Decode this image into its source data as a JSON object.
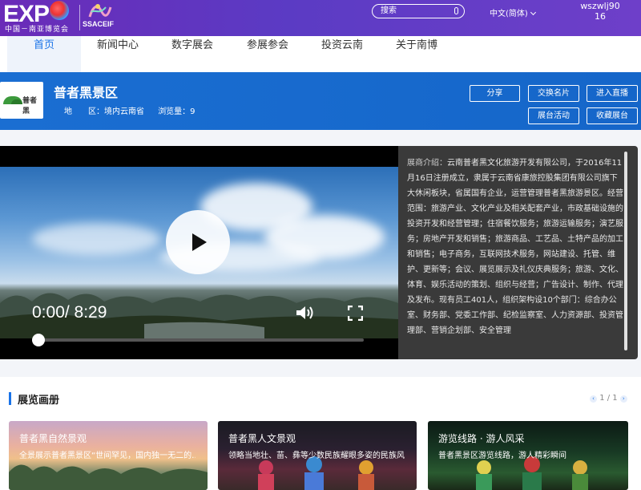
{
  "topbar": {
    "logo_text": "EXP",
    "logo_sub": "中国－南亚博览会",
    "logo_ssaceif": "SSACEIF",
    "search_placeholder": "搜索",
    "language": "中文(简体)",
    "user_line1": "wszwlj90",
    "user_line2": "16"
  },
  "nav": {
    "items": [
      {
        "label": "首页",
        "active": true
      },
      {
        "label": "新闻中心"
      },
      {
        "label": "数字展会"
      },
      {
        "label": "参展参会"
      },
      {
        "label": "投资云南"
      },
      {
        "label": "关于南博"
      }
    ]
  },
  "exhibitor": {
    "logo_text": "普者黑",
    "name": "普者黑景区",
    "region_label": "地　　区：境内云南省",
    "views_label": "浏览量：9",
    "buttons": {
      "share": "分享",
      "exchange_card": "交换名片",
      "live": "进入直播",
      "booth_activity": "展台活动",
      "favorite": "收藏展台"
    }
  },
  "player": {
    "time": "0:00/ 8:29",
    "progress": 0
  },
  "intro": {
    "label": "展商介绍：",
    "text": "云南普者黑文化旅游开发有限公司，于2016年11月16日注册成立，隶属于云南省康旅控股集团有限公司旗下大休闲板块，省属国有企业，运营管理普者黑旅游景区。经营范围：旅游产业、文化产业及相关配套产业，市政基础设施的投资开发和经营管理；住宿餐饮服务；旅游运输服务；演艺服务；房地产开发和销售；旅游商品、工艺品、土特产品的加工和销售；电子商务，互联网技术服务，网站建设、托管、维护、更新等；会议、展览展示及礼仪庆典服务；旅游、文化、体育、娱乐活动的策划、组织与经营；广告设计、制作、代理及发布。现有员工401人，组织架构设10个部门：综合办公室、财务部、党委工作部、纪检监察室、人力资源部、投资管理部、营销企划部、安全管理"
  },
  "album": {
    "title": "展览画册",
    "pager": "1 / 1",
    "cards": [
      {
        "title": "普者黑自然景观",
        "desc": "全景展示普者黑景区“世间罕见，国内独一无二的…"
      },
      {
        "title": "普者黑人文景观",
        "desc": "领略当地壮、苗、彝等少数民族耀眼多姿的民族风情"
      },
      {
        "title": "游览线路 · 游人风采",
        "desc": "普者黑景区游览线路，游人精彩瞬间"
      }
    ]
  },
  "colors": {
    "topbar": "#6a2bb8",
    "header": "#1a6ed2",
    "accent": "#1a73e8"
  }
}
